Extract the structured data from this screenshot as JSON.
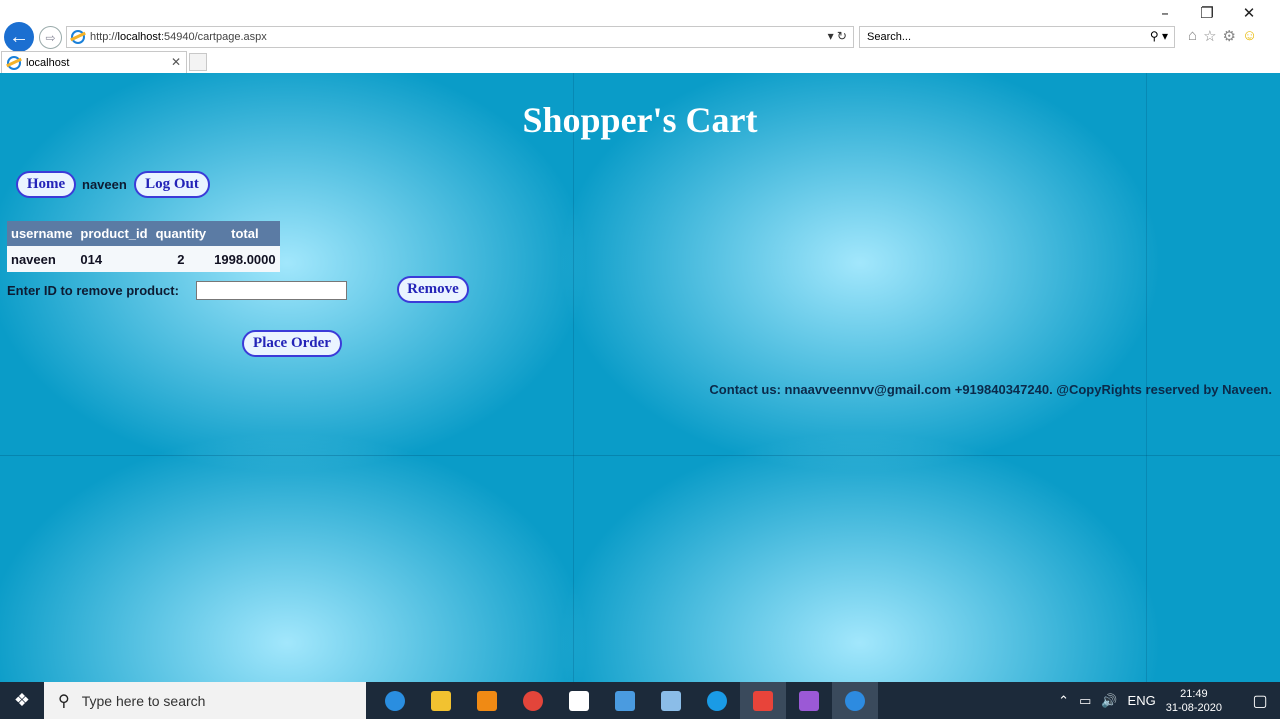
{
  "browser": {
    "url_prefix": "http://",
    "url_host": "localhost",
    "url_rest": ":54940/cartpage.aspx",
    "search_placeholder": "Search...",
    "tab_title": "localhost",
    "window_controls": [
      "–",
      "❐",
      "✕"
    ]
  },
  "page": {
    "title": "Shopper's Cart",
    "nav": {
      "home": "Home",
      "username": "naveen",
      "logout": "Log Out"
    },
    "table": {
      "headers": [
        "username",
        "product_id",
        "quantity",
        "total"
      ],
      "rows": [
        [
          "naveen",
          "014",
          "2",
          "1998.0000"
        ]
      ]
    },
    "remove_label": "Enter ID to remove product:",
    "remove_input_value": "",
    "remove_button": "Remove",
    "place_order_button": "Place Order",
    "contact": "Contact us: nnaavveennvv@gmail.com +919840347240. @CopyRights reserved by Naveen."
  },
  "taskbar": {
    "search_placeholder": "Type here to search",
    "time": "21:49",
    "date": "31-08-2020",
    "lang": "ENG",
    "apps": [
      {
        "name": "edge-icon",
        "color": "#2a8ee0"
      },
      {
        "name": "file-explorer-icon",
        "color": "#f2c230"
      },
      {
        "name": "vlc-icon",
        "color": "#f08a14"
      },
      {
        "name": "chrome-icon",
        "color": "#e3453a"
      },
      {
        "name": "settings-icon",
        "color": "#ffffff"
      },
      {
        "name": "control-panel-icon",
        "color": "#4a9be0"
      },
      {
        "name": "notepad-icon",
        "color": "#8bbde8"
      },
      {
        "name": "skype-icon",
        "color": "#1a9be6"
      },
      {
        "name": "anydesk-icon",
        "color": "#e8443a"
      },
      {
        "name": "visual-studio-icon",
        "color": "#9b59d6"
      },
      {
        "name": "internet-explorer-icon",
        "color": "#2d8be0"
      }
    ]
  }
}
